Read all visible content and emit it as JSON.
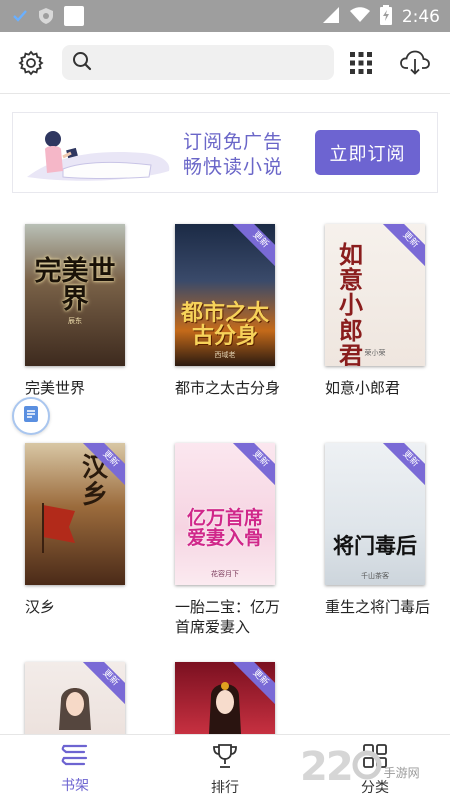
{
  "status_bar": {
    "time": "2:46"
  },
  "search": {
    "placeholder": ""
  },
  "banner": {
    "line1": "订阅免广告",
    "line2": "畅快读小说",
    "button": "立即订阅"
  },
  "badge_label": "更新",
  "books": [
    {
      "title": "完美世界",
      "cover_text": "完美世界",
      "cover_author": "辰东",
      "has_badge": false
    },
    {
      "title": "都市之太古分身",
      "cover_text": "都市之太古分身",
      "cover_author": "西域老",
      "has_badge": true
    },
    {
      "title": "如意小郎君",
      "cover_text": "如意小郎君",
      "cover_author": "荣小荣",
      "has_badge": true
    },
    {
      "title": "汉乡",
      "cover_text": "汉乡",
      "cover_author": "",
      "has_badge": true
    },
    {
      "title": "一胎二宝：亿万首席爱妻入",
      "cover_text": "亿万首席爱妻入骨",
      "cover_author": "花容月下",
      "has_badge": true
    },
    {
      "title": "重生之将门毒后",
      "cover_text": "将门毒后",
      "cover_author": "千山茶客",
      "has_badge": true
    }
  ],
  "bottom_nav": [
    {
      "label": "书架",
      "icon": "bookshelf-icon",
      "active": true
    },
    {
      "label": "排行",
      "icon": "trophy-icon",
      "active": false
    },
    {
      "label": "分类",
      "icon": "category-grid-icon",
      "active": false
    }
  ],
  "watermark": {
    "number": "22",
    "text": "手游网"
  },
  "colors": {
    "accent": "#6d64d1",
    "status_bar": "#9e9e9e",
    "badge": "#7a6ad6"
  }
}
